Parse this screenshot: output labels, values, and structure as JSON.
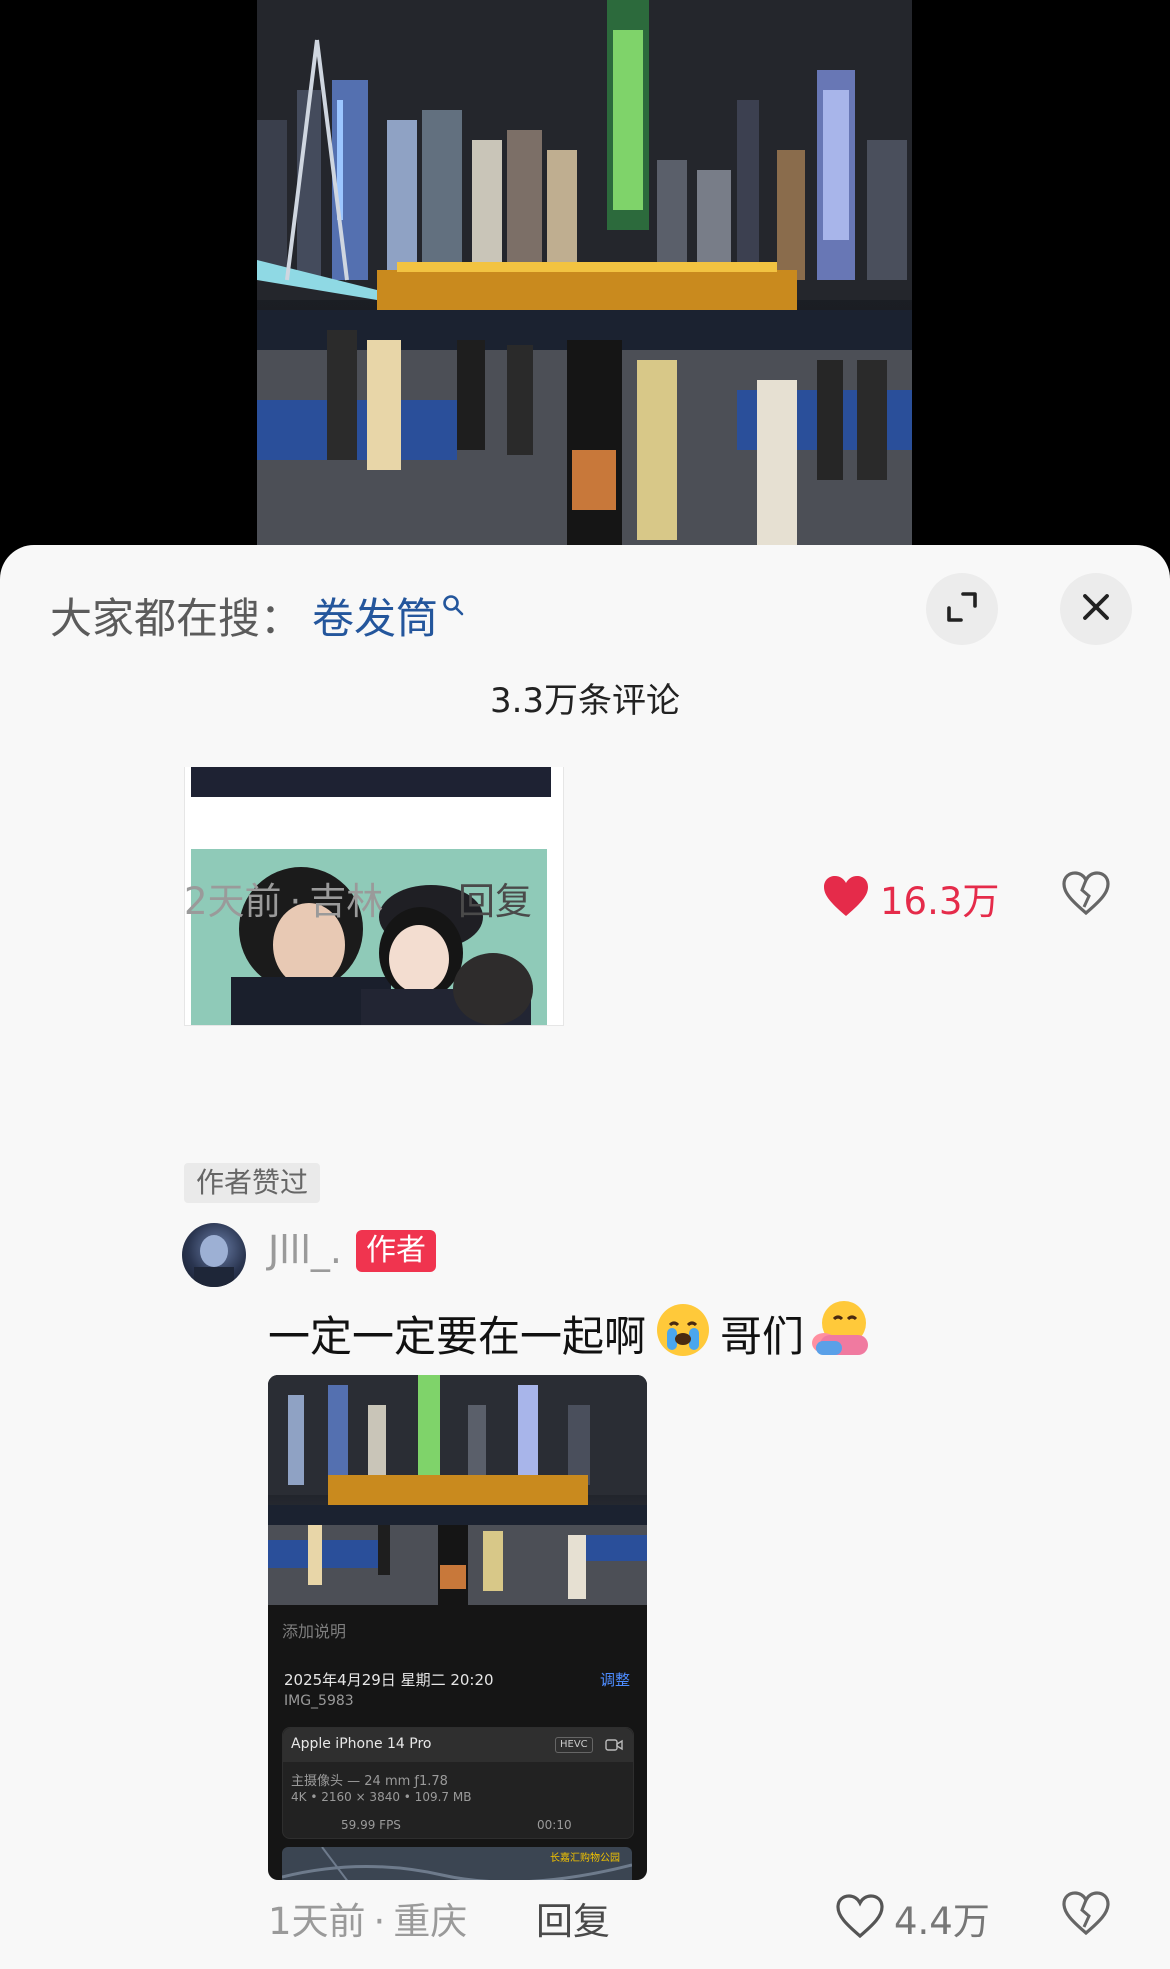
{
  "search": {
    "prefix": "大家都在搜：",
    "term": "卷发筒"
  },
  "header": {
    "comment_count": "3.3万条评论"
  },
  "comment": {
    "time": "2天前",
    "location": "吉林",
    "reply_label": "回复",
    "likes": "16.3万",
    "liked_badge": "作者赞过"
  },
  "reply": {
    "username": "Jlll_.",
    "author_badge": "作者",
    "text_part1": "一定一定要在一起啊",
    "text_part2": "哥们",
    "time": "1天前",
    "location": "重庆",
    "reply_label": "回复",
    "likes": "4.4万"
  },
  "screenshot": {
    "caption": "添加说明",
    "date": "2025年4月29日 星期二 20:20",
    "adjust": "调整",
    "file": "IMG_5983",
    "device": "Apple iPhone 14 Pro",
    "codec": "HEVC",
    "lens": "主摄像头 — 24 mm ƒ1.78",
    "spec": "4K • 2160 × 3840 • 109.7 MB",
    "fps": "59.99 FPS",
    "duration": "00:10",
    "map_label": "长嘉汇购物公园"
  },
  "colors": {
    "accent_red": "#f0344f",
    "link_blue": "#24569c",
    "sheet_bg": "#f8f8f8"
  }
}
